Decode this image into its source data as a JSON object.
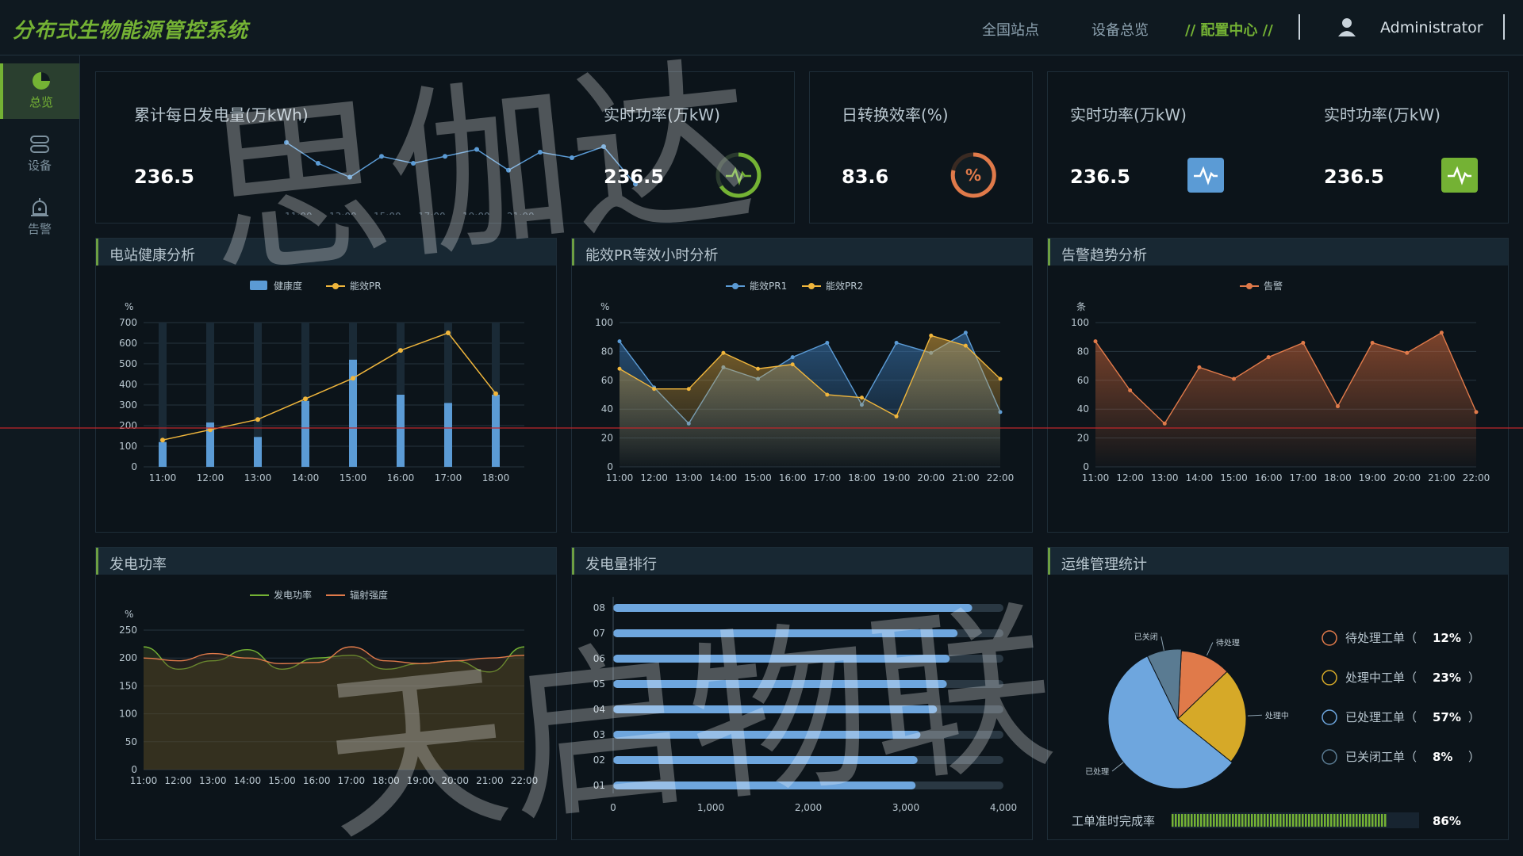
{
  "header": {
    "title": "分布式生物能源管控系统",
    "nav": [
      "全国站点",
      "设备总览",
      "// 配置中心 //"
    ],
    "username": "Administrator"
  },
  "sidebar": {
    "items": [
      {
        "label": "总览",
        "icon": "pie-chart-icon"
      },
      {
        "label": "设备",
        "icon": "device-icon"
      },
      {
        "label": "告警",
        "icon": "alarm-icon"
      }
    ]
  },
  "kpis": {
    "daily_energy": {
      "label": "累计每日发电量(万kWh)",
      "value": "236.5"
    },
    "power1": {
      "label": "实时功率(万kW)",
      "value": "236.5"
    },
    "efficiency": {
      "label": "日转换效率(%)",
      "value": "83.6",
      "icon_text": "%"
    },
    "power2": {
      "label": "实时功率(万kW)",
      "value": "236.5"
    },
    "power3": {
      "label": "实时功率(万kW)",
      "value": "236.5"
    }
  },
  "panels": {
    "health": "电站健康分析",
    "pr": "能效PR等效小时分析",
    "alarm": "告警趋势分析",
    "power": "发电功率",
    "ranking": "发电量排行",
    "ops": "运维管理统计"
  },
  "colors": {
    "accent": "#74b234",
    "blue": "#5b9bd5",
    "yellow": "#f0b63c",
    "orange": "#e07a4a"
  },
  "chart_data": [
    {
      "id": "sparkline",
      "type": "line",
      "x": [
        "11:00",
        "13:00",
        "15:00",
        "17:00",
        "19:00",
        "21:00"
      ],
      "values": [
        75,
        60,
        50,
        65,
        60,
        65,
        70,
        55,
        68,
        64,
        72,
        45
      ]
    },
    {
      "id": "health",
      "type": "bar",
      "title": "电站健康分析",
      "ylabel": "%",
      "ylim": [
        0,
        700
      ],
      "yticks": [
        0,
        100,
        200,
        300,
        400,
        500,
        600,
        700
      ],
      "categories": [
        "11:00",
        "12:00",
        "13:00",
        "14:00",
        "15:00",
        "16:00",
        "17:00",
        "18:00"
      ],
      "series": [
        {
          "name": "健康度",
          "type": "bar",
          "values": [
            120,
            215,
            145,
            320,
            520,
            350,
            310,
            350
          ]
        },
        {
          "name": "能效PR",
          "type": "line",
          "values": [
            130,
            180,
            230,
            330,
            430,
            565,
            650,
            355
          ]
        }
      ]
    },
    {
      "id": "pr",
      "type": "area",
      "title": "能效PR等效小时分析",
      "ylabel": "%",
      "ylim": [
        0,
        100
      ],
      "yticks": [
        0,
        20,
        40,
        60,
        80,
        100
      ],
      "categories": [
        "11:00",
        "12:00",
        "13:00",
        "14:00",
        "15:00",
        "16:00",
        "17:00",
        "18:00",
        "19:00",
        "20:00",
        "21:00",
        "22:00"
      ],
      "series": [
        {
          "name": "能效PR1",
          "values": [
            87,
            55,
            30,
            69,
            61,
            76,
            86,
            43,
            86,
            79,
            93,
            38
          ]
        },
        {
          "name": "能效PR2",
          "values": [
            68,
            54,
            54,
            79,
            68,
            71,
            50,
            48,
            35,
            91,
            84,
            61
          ]
        }
      ]
    },
    {
      "id": "alarm",
      "type": "area",
      "title": "告警趋势分析",
      "ylabel": "条",
      "ylim": [
        0,
        100
      ],
      "yticks": [
        0,
        20,
        40,
        60,
        80,
        100
      ],
      "categories": [
        "11:00",
        "12:00",
        "13:00",
        "14:00",
        "15:00",
        "16:00",
        "17:00",
        "18:00",
        "19:00",
        "20:00",
        "21:00",
        "22:00"
      ],
      "series": [
        {
          "name": "告警",
          "values": [
            87,
            53,
            30,
            69,
            61,
            76,
            86,
            42,
            86,
            79,
            93,
            38
          ]
        }
      ]
    },
    {
      "id": "power",
      "type": "area",
      "title": "发电功率",
      "ylabel": "%",
      "ylim": [
        0,
        250
      ],
      "yticks": [
        0,
        50,
        100,
        150,
        200,
        250
      ],
      "categories": [
        "11:00",
        "12:00",
        "13:00",
        "14:00",
        "15:00",
        "16:00",
        "17:00",
        "18:00",
        "19:00",
        "20:00",
        "21:00",
        "22:00"
      ],
      "series": [
        {
          "name": "发电功率",
          "values": [
            220,
            180,
            195,
            215,
            180,
            200,
            205,
            180,
            190,
            195,
            175,
            220
          ]
        },
        {
          "name": "辐射强度",
          "values": [
            200,
            195,
            208,
            200,
            190,
            192,
            220,
            195,
            190,
            195,
            200,
            205
          ]
        }
      ]
    },
    {
      "id": "ranking",
      "type": "bar",
      "orientation": "horizontal",
      "title": "发电量排行",
      "xlim": [
        0,
        4000
      ],
      "xticks": [
        "0",
        "1,000",
        "2,000",
        "3,000",
        "4,000"
      ],
      "categories": [
        "08",
        "07",
        "06",
        "05",
        "04",
        "03",
        "02",
        "01"
      ],
      "values": [
        3680,
        3530,
        3450,
        3420,
        3320,
        3150,
        3120,
        3100
      ]
    },
    {
      "id": "ops",
      "type": "pie",
      "title": "运维管理统计",
      "slices": [
        {
          "label": "待处理",
          "legend": "待处理工单",
          "value": 12,
          "pct": "12%",
          "color": "#e07a4a",
          "icon": "hourglass-icon"
        },
        {
          "label": "处理中",
          "legend": "处理中工单",
          "value": 23,
          "pct": "23%",
          "color": "#d6a928",
          "icon": "clock-icon"
        },
        {
          "label": "已处理",
          "legend": "已处理工单",
          "value": 57,
          "pct": "57%",
          "color": "#6ea6de",
          "icon": "check-circle-icon"
        },
        {
          "label": "已关闭",
          "legend": "已关闭工单",
          "value": 8,
          "pct": "8%",
          "color": "#5a7b92",
          "icon": "close-circle-icon"
        }
      ],
      "completion": {
        "label": "工单准时完成率",
        "value": 86,
        "text": "86%"
      }
    }
  ],
  "watermark": {
    "line1": "思伽达",
    "line2": "天启物联"
  }
}
